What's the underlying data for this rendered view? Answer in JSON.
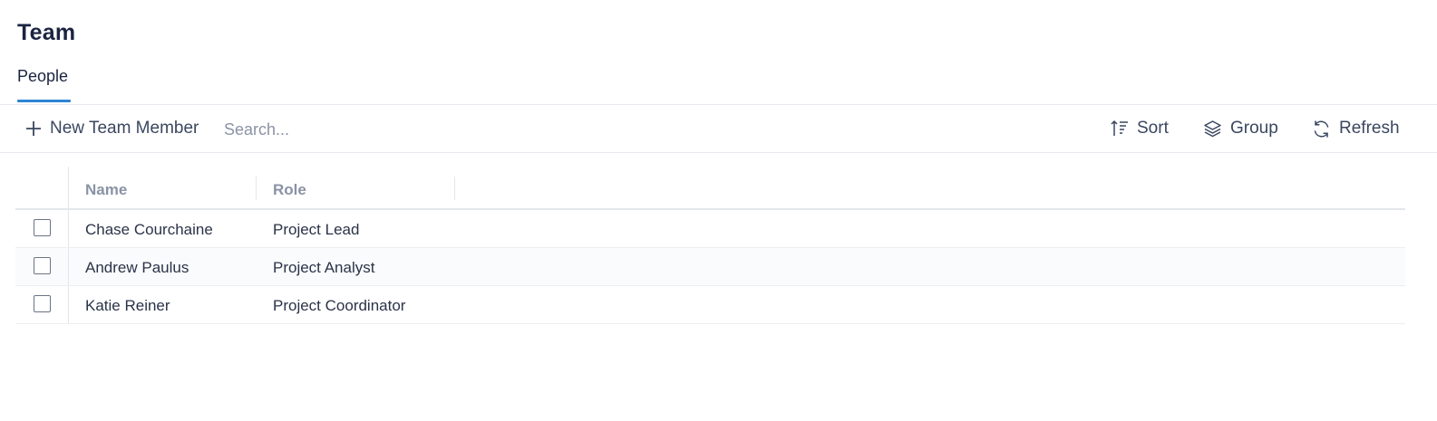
{
  "page": {
    "title": "Team"
  },
  "tabs": [
    {
      "label": "People",
      "active": true
    }
  ],
  "toolbar": {
    "new_member_label": "New Team Member",
    "search_placeholder": "Search...",
    "sort_label": "Sort",
    "group_label": "Group",
    "refresh_label": "Refresh"
  },
  "table": {
    "columns": [
      "Name",
      "Role"
    ],
    "rows": [
      {
        "name": "Chase Courchaine",
        "role": "Project Lead",
        "checked": false
      },
      {
        "name": "Andrew Paulus",
        "role": "Project Analyst",
        "checked": false
      },
      {
        "name": "Katie Reiner",
        "role": "Project Coordinator",
        "checked": false
      }
    ]
  },
  "colors": {
    "accent": "#2f84d3",
    "title": "#1b2440",
    "muted": "#8a93a5"
  },
  "icons": {
    "new_member": "plus-icon",
    "sort": "sort-ascending-icon",
    "group": "layers-icon",
    "refresh": "refresh-icon"
  }
}
